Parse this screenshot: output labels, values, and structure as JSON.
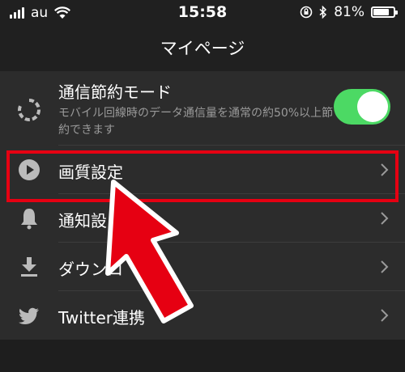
{
  "status_bar": {
    "carrier": "au",
    "time": "15:58",
    "battery": "81%",
    "battery_level": 0.81,
    "icons": [
      "signal-icon",
      "wifi-icon",
      "orientation-lock-icon",
      "bluetooth-icon",
      "battery-icon"
    ]
  },
  "nav": {
    "title": "マイページ"
  },
  "settings": {
    "data_saver": {
      "label": "通信節約モード",
      "description": "モバイル回線時のデータ通信量を通常の約50%以上節約できます",
      "enabled": true,
      "icon": "data-saver-icon"
    },
    "quality": {
      "label": "画質設定",
      "icon": "play-circle-icon"
    },
    "notifications": {
      "label": "通知設",
      "icon": "bell-icon"
    },
    "downloads": {
      "label": "ダウンロ",
      "icon": "download-icon"
    },
    "twitter": {
      "label": "Twitter連携",
      "icon": "twitter-icon"
    }
  },
  "colors": {
    "toggle_on": "#4cd964",
    "highlight": "#e60012",
    "background": "#2c2c2c"
  }
}
